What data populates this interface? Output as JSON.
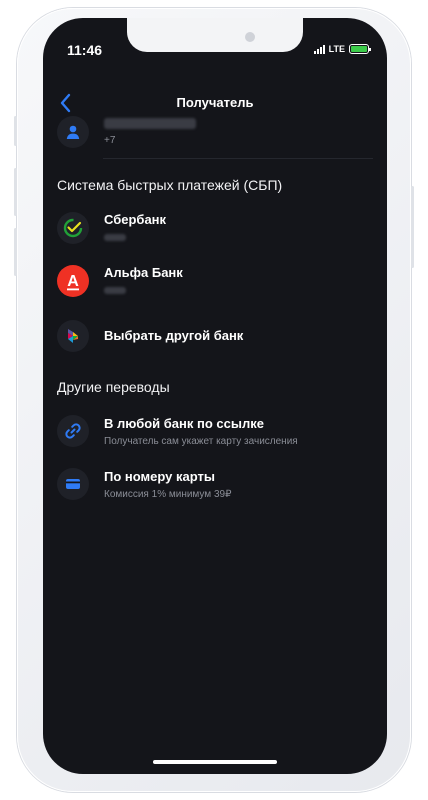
{
  "status_bar": {
    "time": "11:46",
    "network": "LTE"
  },
  "header": {
    "title": "Получатель"
  },
  "recipient": {
    "phone_prefix": "+7"
  },
  "sbp": {
    "section_title": "Система быстрых платежей (СБП)",
    "banks": [
      {
        "name": "Сбербанк"
      },
      {
        "name": "Альфа Банк",
        "icon_letter": "А"
      }
    ],
    "other_bank_label": "Выбрать другой банк"
  },
  "other": {
    "section_title": "Другие переводы",
    "items": [
      {
        "title": "В любой банк по ссылке",
        "subtitle": "Получатель сам укажет карту зачисления"
      },
      {
        "title": "По номеру карты",
        "subtitle": "Комиссия 1% минимум 39₽"
      }
    ]
  },
  "colors": {
    "background": "#14151a",
    "accent_blue": "#2f7bf5",
    "sber_green": "#21a038",
    "alfa_red": "#ef3124"
  }
}
